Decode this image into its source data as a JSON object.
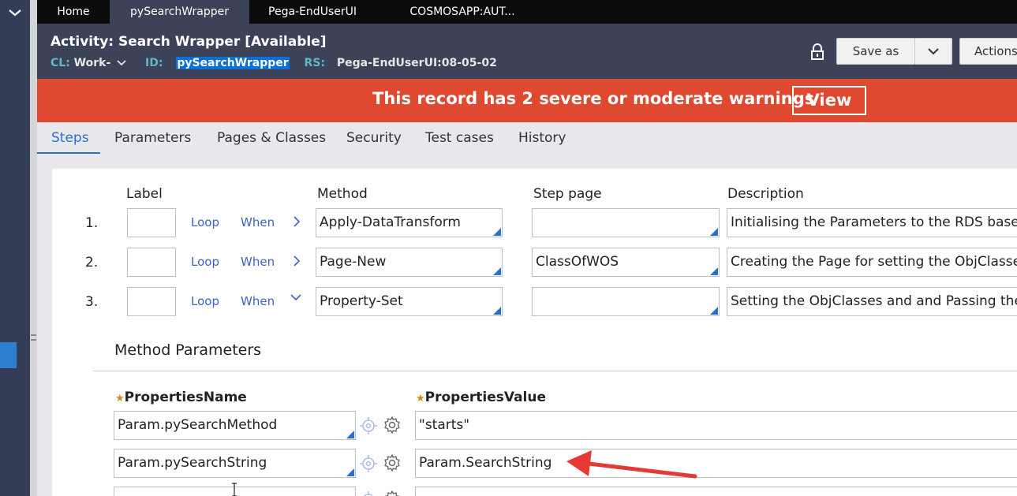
{
  "tabs": [
    {
      "label": "Home"
    },
    {
      "label": "pySearchWrapper"
    },
    {
      "label": "Pega-EndUserUI"
    },
    {
      "label": "COSMOSAPP:AUT..."
    }
  ],
  "header": {
    "title": "Activity: Search Wrapper [Available]",
    "cl_key": "CL:",
    "cl_value": "Work-",
    "id_key": "ID:",
    "id_value": "pySearchWrapper",
    "rs_key": "RS:",
    "rs_value": "Pega-EndUserUI:08-05-02",
    "save_as_label": "Save as",
    "actions_label": "Actions"
  },
  "warning": {
    "text": "This record has 2 severe or moderate warnings",
    "view_label": "View"
  },
  "rule_tabs": [
    {
      "label": "Steps"
    },
    {
      "label": "Parameters"
    },
    {
      "label": "Pages & Classes"
    },
    {
      "label": "Security"
    },
    {
      "label": "Test cases"
    },
    {
      "label": "History"
    }
  ],
  "steps": {
    "col_label": "Label",
    "col_method": "Method",
    "col_step_page": "Step page",
    "col_description": "Description",
    "loop_label": "Loop",
    "when_label": "When",
    "rows": [
      {
        "num": "1.",
        "method": "Apply-DataTransform",
        "step_page": "",
        "description": "Initialising the Parameters to the RDS based on"
      },
      {
        "num": "2.",
        "method": "Page-New",
        "step_page": "ClassOfWOS",
        "description": "Creating the Page for setting the ObjClasses"
      },
      {
        "num": "3.",
        "method": "Property-Set",
        "step_page": "",
        "description": "Setting the ObjClasses and and Passing the Param"
      }
    ]
  },
  "method_params": {
    "title": "Method Parameters",
    "col_name": "PropertiesName",
    "col_value": "PropertiesValue",
    "rows": [
      {
        "name": "Param.pySearchMethod",
        "value": "\"starts\""
      },
      {
        "name": "Param.pySearchString",
        "value": "Param.SearchString"
      }
    ]
  },
  "colors": {
    "warning_bg": "#de4930",
    "header_bg": "#3c4258",
    "accent": "#2a6ed1",
    "arrow": "#e53935"
  }
}
